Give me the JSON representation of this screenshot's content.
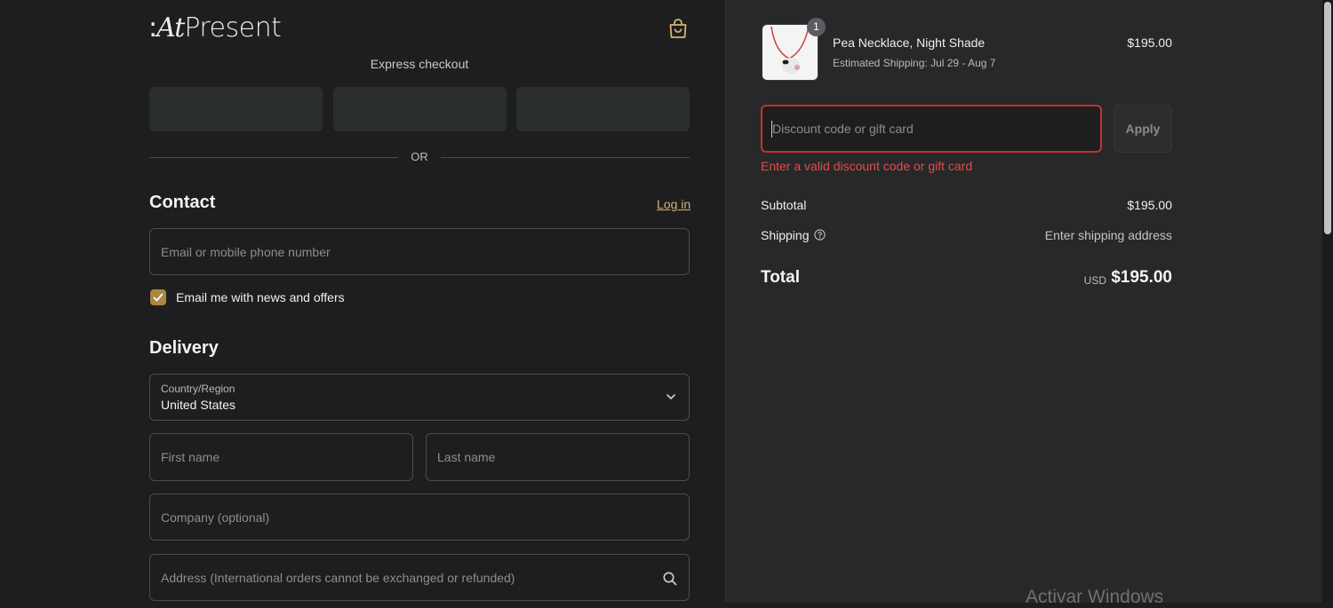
{
  "brand": {
    "logo_prefix": ":",
    "logo_at": "At",
    "logo_rest": "Present"
  },
  "express": {
    "title": "Express checkout",
    "divider": "OR"
  },
  "contact": {
    "title": "Contact",
    "login_link": "Log in",
    "email_placeholder": "Email or mobile phone number",
    "newsletter_label": "Email me with news and offers",
    "newsletter_checked": true
  },
  "delivery": {
    "title": "Delivery",
    "country_label": "Country/Region",
    "country_value": "United States",
    "first_name_placeholder": "First name",
    "last_name_placeholder": "Last name",
    "company_placeholder": "Company (optional)",
    "address_placeholder": "Address (International orders cannot be exchanged or refunded)"
  },
  "order": {
    "item": {
      "name": "Pea Necklace, Night Shade",
      "shipping": "Estimated Shipping: Jul 29 - Aug 7",
      "price": "$195.00",
      "quantity": "1"
    },
    "discount": {
      "placeholder": "Discount code or gift card",
      "apply_label": "Apply",
      "error": "Enter a valid discount code or gift card"
    },
    "summary": {
      "subtotal_label": "Subtotal",
      "subtotal_value": "$195.00",
      "shipping_label": "Shipping",
      "shipping_value": "Enter shipping address",
      "total_label": "Total",
      "currency": "USD",
      "total_value": "$195.00"
    }
  },
  "os_watermark": "Activar Windows",
  "colors": {
    "accent": "#d7b274",
    "checkbox": "#a8873f",
    "error": "#e24d45",
    "left_bg": "#1e1e20",
    "right_bg": "#27282a"
  },
  "icons": [
    "shopping-bag-icon",
    "chevron-down-icon",
    "search-icon",
    "help-circle-icon",
    "checkmark-icon"
  ]
}
